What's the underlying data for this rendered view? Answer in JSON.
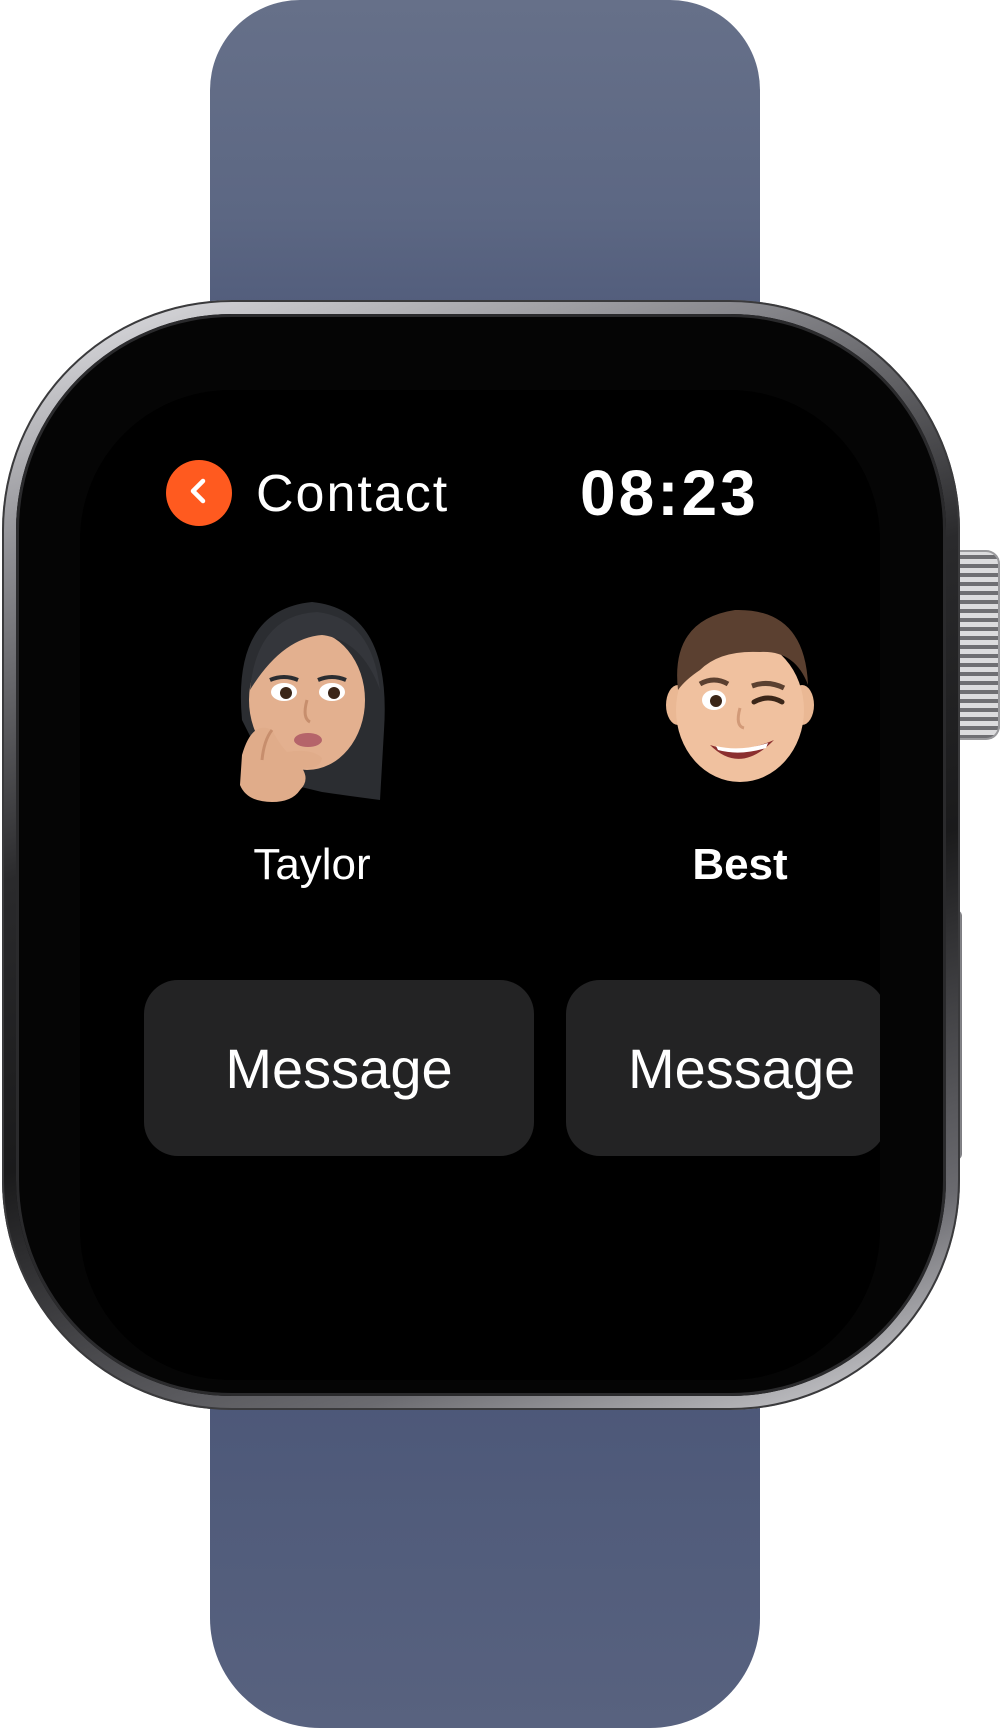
{
  "header": {
    "back_icon": "chevron-left-icon",
    "title": "Contact",
    "time": "08:23"
  },
  "contacts": [
    {
      "name": "Taylor",
      "avatar_icon": "memoji-thinking-woman-icon",
      "action_label": "Message"
    },
    {
      "name": "Best",
      "avatar_icon": "memoji-winking-man-icon",
      "action_label": "Message"
    }
  ],
  "colors": {
    "accent": "#ff5a1f",
    "screen_background": "#000000",
    "button_background": "#232324",
    "band": "#5c6783"
  }
}
